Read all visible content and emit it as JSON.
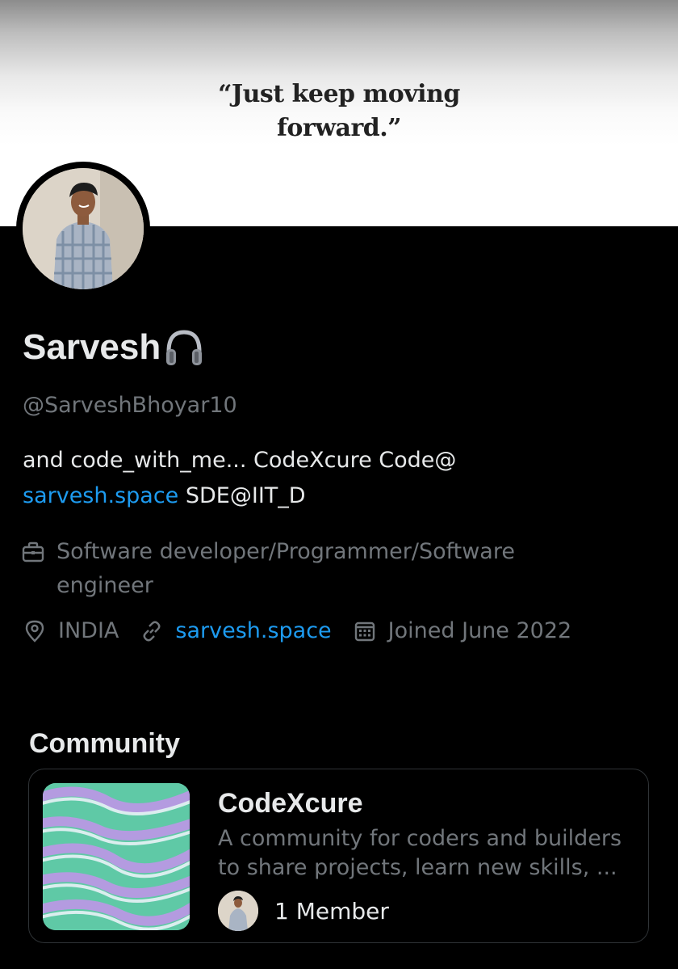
{
  "banner": {
    "quote_line1": "“Just keep moving",
    "quote_line2": "forward.”"
  },
  "profile": {
    "name": "Sarvesh",
    "name_emoji": "headphone-icon",
    "handle": "@SarveshBhoyar10",
    "bio_text": "and code_with_me... CodeXcure  Code@",
    "bio_link": "sarvesh.space",
    "bio_suffix": " SDE@IIT_D",
    "occupation": "Software developer/Programmer/Software engineer",
    "location": "INDIA",
    "website": "sarvesh.space",
    "joined": "Joined June 2022"
  },
  "community": {
    "section_title": "Community",
    "name": "CodeXcure",
    "description_line1": "A community for coders and builders",
    "description_line2": "to share projects, learn new skills, ...",
    "members": "1 Member"
  },
  "colors": {
    "background": "#000000",
    "text_primary": "#e7e9ea",
    "text_secondary": "#71767b",
    "link": "#1d9bf0",
    "border": "#2f3336"
  }
}
